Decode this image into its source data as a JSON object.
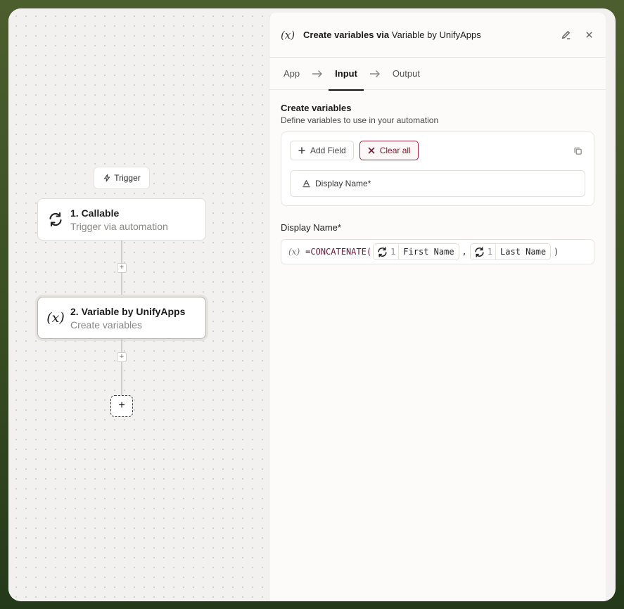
{
  "canvas": {
    "trigger_label": "Trigger",
    "nodes": [
      {
        "title": "1. Callable",
        "subtitle": "Trigger via automation",
        "icon": "refresh-icon"
      },
      {
        "title": "2. Variable by UnifyApps",
        "subtitle": "Create variables",
        "icon": "variable-icon",
        "icon_text": "(x)"
      }
    ]
  },
  "panel": {
    "icon_text": "(x)",
    "title_bold": "Create variables via",
    "title_light": "Variable by UnifyApps",
    "tabs": [
      {
        "label": "App"
      },
      {
        "label": "Input",
        "active": true
      },
      {
        "label": "Output"
      }
    ],
    "section_title": "Create variables",
    "section_desc": "Define variables to use in your automation",
    "add_field_label": "Add Field",
    "clear_all_label": "Clear all",
    "field_chip_label": "Display Name*",
    "field_label": "Display Name*",
    "formula": {
      "fx": "(x)",
      "fn": "=CONCATENATE(",
      "ref1_step": "1",
      "ref1_label": "First Name",
      "comma": ",",
      "ref2_step": "1",
      "ref2_label": "Last Name",
      "close": ")"
    }
  },
  "colors": {
    "accent_danger": "#a3263f",
    "function_color": "#6e1a3a",
    "background_green": "#3a4f22"
  }
}
